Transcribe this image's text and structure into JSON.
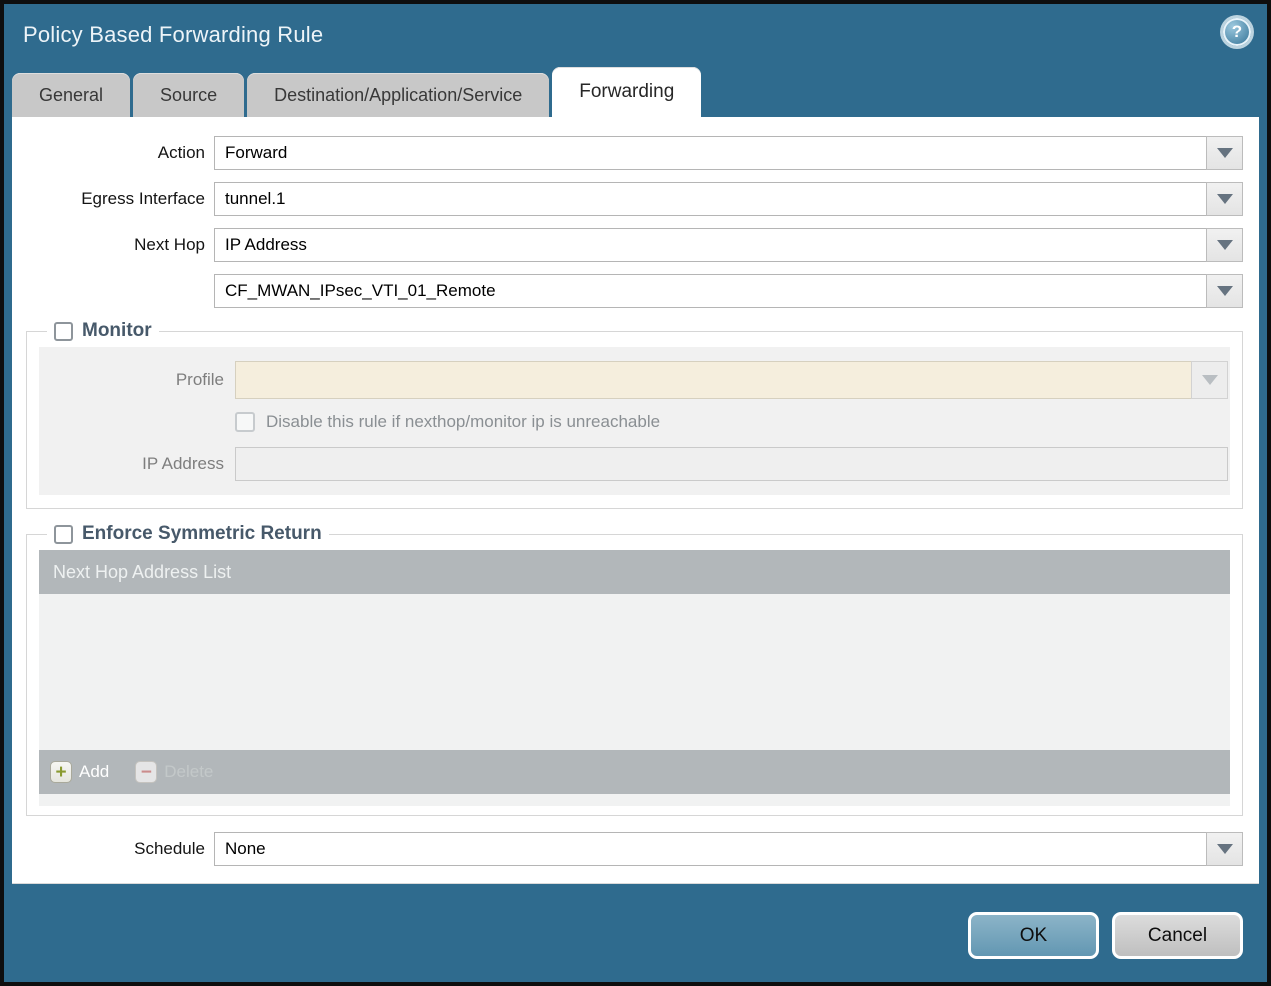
{
  "window": {
    "title": "Policy Based Forwarding Rule"
  },
  "icons": {
    "help": "?",
    "add": "+",
    "delete": "−",
    "dropdown": "chevron-down"
  },
  "tabs": [
    {
      "label": "General",
      "active": false
    },
    {
      "label": "Source",
      "active": false
    },
    {
      "label": "Destination/Application/Service",
      "active": false
    },
    {
      "label": "Forwarding",
      "active": true
    }
  ],
  "form": {
    "action": {
      "label": "Action",
      "value": "Forward"
    },
    "egress_interface": {
      "label": "Egress Interface",
      "value": "tunnel.1"
    },
    "next_hop_type": {
      "label": "Next Hop",
      "value": "IP Address"
    },
    "next_hop_address": {
      "label": "",
      "value": "CF_MWAN_IPsec_VTI_01_Remote"
    },
    "schedule": {
      "label": "Schedule",
      "value": "None"
    }
  },
  "monitor": {
    "title": "Monitor",
    "checked": false,
    "profile": {
      "label": "Profile",
      "value": ""
    },
    "disable_rule": {
      "label": "Disable this rule if nexthop/monitor ip is unreachable",
      "checked": false
    },
    "ip_address": {
      "label": "IP Address",
      "value": ""
    }
  },
  "enforce": {
    "title": "Enforce Symmetric Return",
    "checked": false,
    "table": {
      "header": "Next Hop Address List",
      "rows": []
    },
    "add_label": "Add",
    "delete_label": "Delete"
  },
  "actions": {
    "ok": "OK",
    "cancel": "Cancel"
  },
  "colors": {
    "frame_teal": "#2f6b8e",
    "ok_button_blue": "#6fa2bb",
    "cancel_button_gray": "#cccccc",
    "profile_disabled_field": "#f5eedd",
    "table_chrome_gray": "#b2b7ba",
    "add_plus_green": "#8a9a30",
    "delete_minus_red": "#d08585",
    "group_label_slate": "#47596a"
  }
}
